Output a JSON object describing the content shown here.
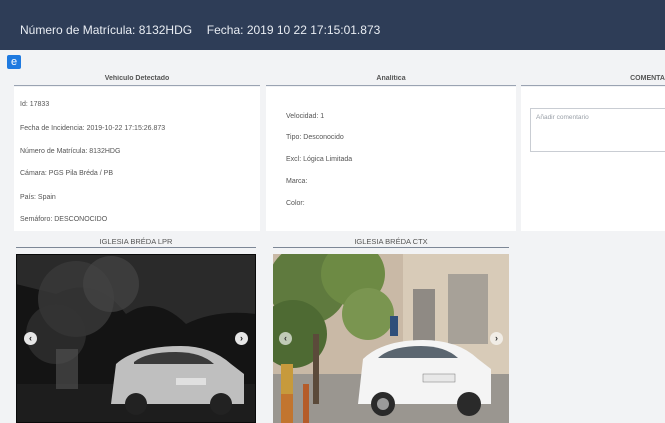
{
  "header": {
    "plate_label": "Número de Matrícula:",
    "plate_value": "8132HDG",
    "date_label": "Fecha:",
    "date_value": "2019 10 22 17:15:01.873"
  },
  "back_button": {
    "label": "e"
  },
  "vehicle_panel": {
    "title": "Vehículo Detectado",
    "rows": [
      {
        "label": "Id:",
        "value": "17833"
      },
      {
        "label": "Fecha de Incidencia:",
        "value": "2019-10-22 17:15:26.873"
      },
      {
        "label": "Número de Matrícula:",
        "value": "8132HDG"
      },
      {
        "label": "Cámara:",
        "value": "PGS Pila Bréda / PB"
      },
      {
        "label": "País:",
        "value": "Spain"
      },
      {
        "label": "Semáforo:",
        "value": "DESCONOCIDO"
      }
    ]
  },
  "analytics_panel": {
    "title": "Analítica",
    "rows": [
      {
        "label": "Velocidad:",
        "value": "1"
      },
      {
        "label": "Tipo:",
        "value": "Desconocido"
      },
      {
        "label": "Excl:",
        "value": "Lógica Limitada"
      },
      {
        "label": "Marca:",
        "value": ""
      },
      {
        "label": "Color:",
        "value": ""
      }
    ]
  },
  "comments_panel": {
    "title": "COMENTA",
    "placeholder": "Añadir comentario"
  },
  "cameras": [
    {
      "title": "IGLESIA BRÉDA LPR",
      "prev": "‹",
      "next": "›"
    },
    {
      "title": "IGLESIA BRÉDA CTX",
      "prev": "‹",
      "next": "›"
    }
  ],
  "colors": {
    "header": "#2e3d57",
    "accent": "#1f7ae0"
  }
}
